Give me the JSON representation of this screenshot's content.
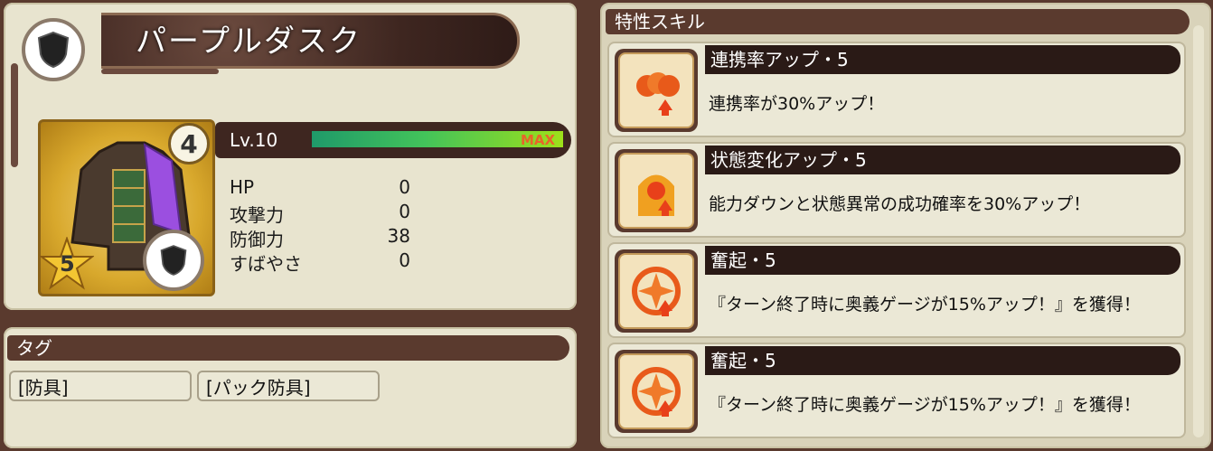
{
  "item": {
    "name": "パープルダスク",
    "level_label": "Lv.10",
    "max_label": "MAX",
    "exp_fraction": 1.0,
    "rarity_level": "4",
    "stars": "5"
  },
  "stats": [
    {
      "label": "HP",
      "value": "0"
    },
    {
      "label": "攻撃力",
      "value": "0"
    },
    {
      "label": "防御力",
      "value": "38"
    },
    {
      "label": "すばやさ",
      "value": "0"
    }
  ],
  "tags": {
    "header": "タグ",
    "items": [
      "[防具]",
      "[パック防具]"
    ]
  },
  "skills": {
    "header": "特性スキル",
    "items": [
      {
        "name": "連携率アップ・5",
        "desc": "連携率が30%アップ！",
        "icon": "chain-rate-icon"
      },
      {
        "name": "状態変化アップ・5",
        "desc": "能力ダウンと状態異常の成功確率を30%アップ！",
        "icon": "status-change-icon"
      },
      {
        "name": "奮起・5",
        "desc": "『ターン終了時に奥義ゲージが15%アップ！』を獲得！",
        "icon": "rouse-icon"
      },
      {
        "name": "奮起・5",
        "desc": "『ターン終了時に奥義ゲージが15%アップ！』を獲得！",
        "icon": "rouse-icon"
      }
    ]
  },
  "colors": {
    "banner": "#3e2620",
    "panel": "#e8e4cf",
    "max": "#e8652a"
  }
}
